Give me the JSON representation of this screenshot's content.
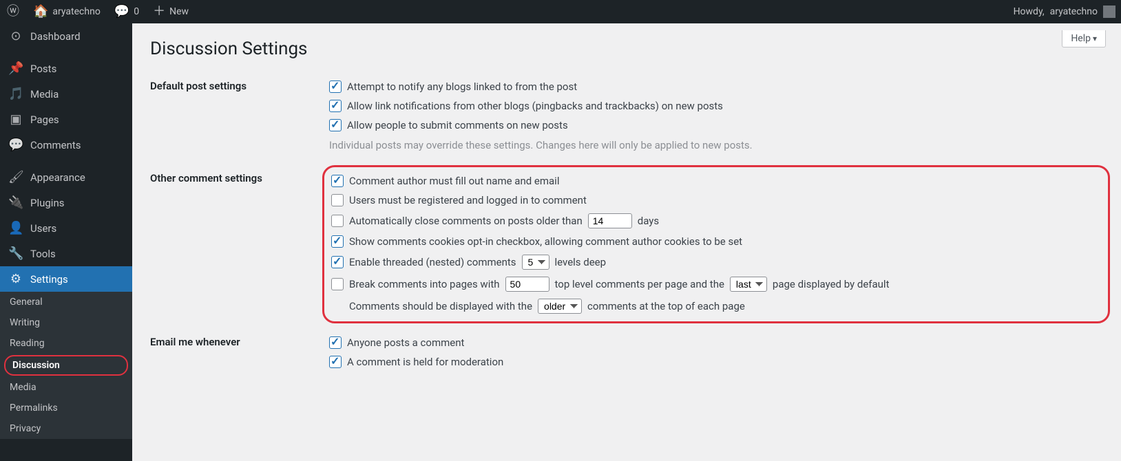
{
  "adminbar": {
    "site_name": "aryatechno",
    "comments_count": "0",
    "new_label": "New",
    "howdy_prefix": "Howdy, ",
    "username": "aryatechno"
  },
  "sidebar": {
    "items": [
      {
        "icon": "◷",
        "label": "Dashboard"
      },
      {
        "icon": "✎",
        "label": "Posts"
      },
      {
        "icon": "🎵",
        "label": "Media"
      },
      {
        "icon": "▣",
        "label": "Pages"
      },
      {
        "icon": "💬",
        "label": "Comments"
      },
      {
        "icon": "✎",
        "label": "Appearance"
      },
      {
        "icon": "🔌",
        "label": "Plugins"
      },
      {
        "icon": "👤",
        "label": "Users"
      },
      {
        "icon": "🔧",
        "label": "Tools"
      },
      {
        "icon": "⚙",
        "label": "Settings"
      }
    ],
    "sub_items": [
      {
        "label": "General"
      },
      {
        "label": "Writing"
      },
      {
        "label": "Reading"
      },
      {
        "label": "Discussion"
      },
      {
        "label": "Media"
      },
      {
        "label": "Permalinks"
      },
      {
        "label": "Privacy"
      }
    ]
  },
  "help_label": "Help",
  "page_title": "Discussion Settings",
  "sections": {
    "default_post": {
      "heading": "Default post settings",
      "opt1_checked": true,
      "opt1": "Attempt to notify any blogs linked to from the post",
      "opt2_checked": true,
      "opt2": "Allow link notifications from other blogs (pingbacks and trackbacks) on new posts",
      "opt3_checked": true,
      "opt3": "Allow people to submit comments on new posts",
      "note": "Individual posts may override these settings. Changes here will only be applied to new posts."
    },
    "other_comment": {
      "heading": "Other comment settings",
      "opt1_checked": true,
      "opt1": "Comment author must fill out name and email",
      "opt2_checked": false,
      "opt2": "Users must be registered and logged in to comment",
      "opt3_checked": false,
      "opt3_pre": "Automatically close comments on posts older than",
      "opt3_value": "14",
      "opt3_post": "days",
      "opt4_checked": true,
      "opt4": "Show comments cookies opt-in checkbox, allowing comment author cookies to be set",
      "opt5_checked": true,
      "opt5_pre": "Enable threaded (nested) comments",
      "opt5_value": "5",
      "opt5_post": "levels deep",
      "opt6_checked": false,
      "opt6_pre": "Break comments into pages with",
      "opt6_value": "50",
      "opt6_mid": "top level comments per page and the",
      "opt6_select": "last",
      "opt6_post": "page displayed by default",
      "opt7_pre": "Comments should be displayed with the",
      "opt7_select": "older",
      "opt7_post": "comments at the top of each page"
    },
    "email_me": {
      "heading": "Email me whenever",
      "opt1_checked": true,
      "opt1": "Anyone posts a comment",
      "opt2_checked": true,
      "opt2": "A comment is held for moderation"
    }
  }
}
